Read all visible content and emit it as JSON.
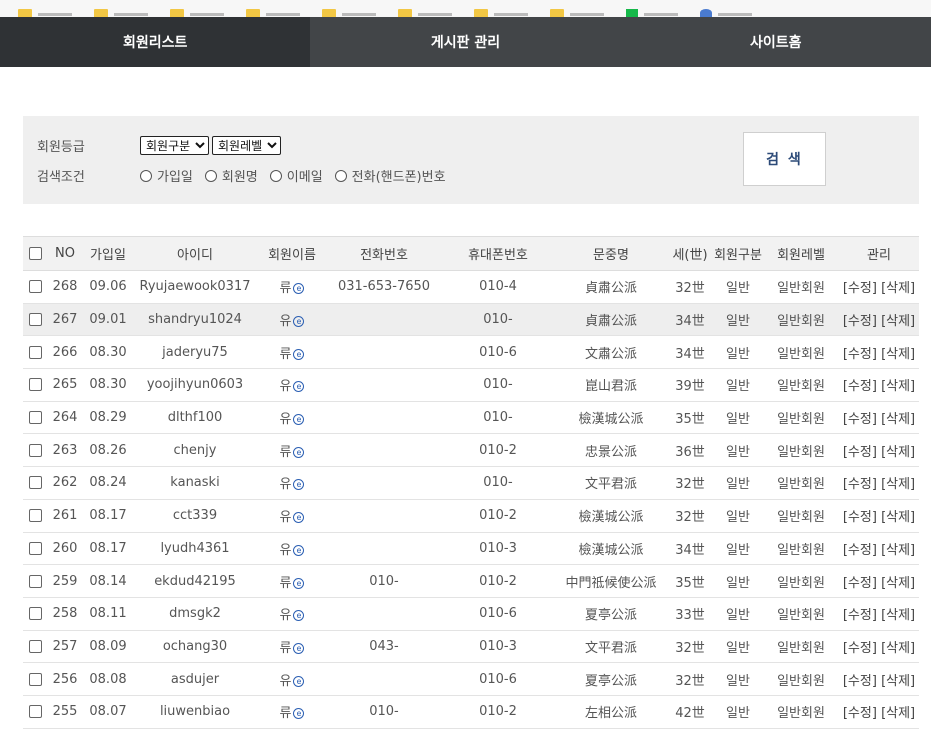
{
  "nav": {
    "tabs": [
      {
        "label": "회원리스트",
        "active": true
      },
      {
        "label": "게시판 관리",
        "active": false
      },
      {
        "label": "사이트홈",
        "active": false
      }
    ]
  },
  "search": {
    "grade_label": "회원등급",
    "type_select": "회원구분",
    "level_select": "회원레벨",
    "condition_label": "검색조건",
    "options": [
      "가입일",
      "회원명",
      "이메일",
      "전화(핸드폰)번호"
    ],
    "button": "검 색"
  },
  "table": {
    "headers": [
      "NO",
      "가입일",
      "아이디",
      "회원이름",
      "전화번호",
      "휴대폰번호",
      "문중명",
      "세(世)",
      "회원구분",
      "회원레벨",
      "관리"
    ],
    "edit_label": "[수정]",
    "delete_label": "[삭제]",
    "rows": [
      {
        "no": "268",
        "date": "09.06",
        "id": "Ryujaewook0317",
        "name": "류",
        "tel": "031-653-7650",
        "mobile": "010-4",
        "clan": "貞肅公派",
        "gen": "32世",
        "type": "일반",
        "level": "일반회원"
      },
      {
        "no": "267",
        "date": "09.01",
        "id": "shandryu1024",
        "name": "유",
        "tel": "",
        "mobile": "010-",
        "clan": "貞肅公派",
        "gen": "34世",
        "type": "일반",
        "level": "일반회원"
      },
      {
        "no": "266",
        "date": "08.30",
        "id": "jaderyu75",
        "name": "류",
        "tel": "",
        "mobile": "010-6",
        "clan": "文肅公派",
        "gen": "34世",
        "type": "일반",
        "level": "일반회원"
      },
      {
        "no": "265",
        "date": "08.30",
        "id": "yoojihyun0603",
        "name": "유",
        "tel": "",
        "mobile": "010-",
        "clan": "崑山君派",
        "gen": "39世",
        "type": "일반",
        "level": "일반회원"
      },
      {
        "no": "264",
        "date": "08.29",
        "id": "dlthf100",
        "name": "유",
        "tel": "",
        "mobile": "010-",
        "clan": "檢漢城公派",
        "gen": "35世",
        "type": "일반",
        "level": "일반회원"
      },
      {
        "no": "263",
        "date": "08.26",
        "id": "chenjy",
        "name": "류",
        "tel": "",
        "mobile": "010-2",
        "clan": "忠景公派",
        "gen": "36世",
        "type": "일반",
        "level": "일반회원"
      },
      {
        "no": "262",
        "date": "08.24",
        "id": "kanaski",
        "name": "유",
        "tel": "",
        "mobile": "010-",
        "clan": "文平君派",
        "gen": "32世",
        "type": "일반",
        "level": "일반회원"
      },
      {
        "no": "261",
        "date": "08.17",
        "id": "cct339",
        "name": "유",
        "tel": "",
        "mobile": "010-2",
        "clan": "檢漢城公派",
        "gen": "32世",
        "type": "일반",
        "level": "일반회원"
      },
      {
        "no": "260",
        "date": "08.17",
        "id": "lyudh4361",
        "name": "유",
        "tel": "",
        "mobile": "010-3",
        "clan": "檢漢城公派",
        "gen": "34世",
        "type": "일반",
        "level": "일반회원"
      },
      {
        "no": "259",
        "date": "08.14",
        "id": "ekdud42195",
        "name": "류",
        "tel": "010-",
        "mobile": "010-2",
        "clan": "中門祗候使公派",
        "gen": "35世",
        "type": "일반",
        "level": "일반회원"
      },
      {
        "no": "258",
        "date": "08.11",
        "id": "dmsgk2",
        "name": "유",
        "tel": "",
        "mobile": "010-6",
        "clan": "夏亭公派",
        "gen": "33世",
        "type": "일반",
        "level": "일반회원"
      },
      {
        "no": "257",
        "date": "08.09",
        "id": "ochang30",
        "name": "류",
        "tel": "043-",
        "mobile": "010-3",
        "clan": "文平君派",
        "gen": "32世",
        "type": "일반",
        "level": "일반회원"
      },
      {
        "no": "256",
        "date": "08.08",
        "id": "asdujer",
        "name": "유",
        "tel": "",
        "mobile": "010-6",
        "clan": "夏亭公派",
        "gen": "32世",
        "type": "일반",
        "level": "일반회원"
      },
      {
        "no": "255",
        "date": "08.07",
        "id": "liuwenbiao",
        "name": "류",
        "tel": "010-",
        "mobile": "010-2",
        "clan": "左相公派",
        "gen": "42世",
        "type": "일반",
        "level": "일반회원"
      }
    ]
  }
}
